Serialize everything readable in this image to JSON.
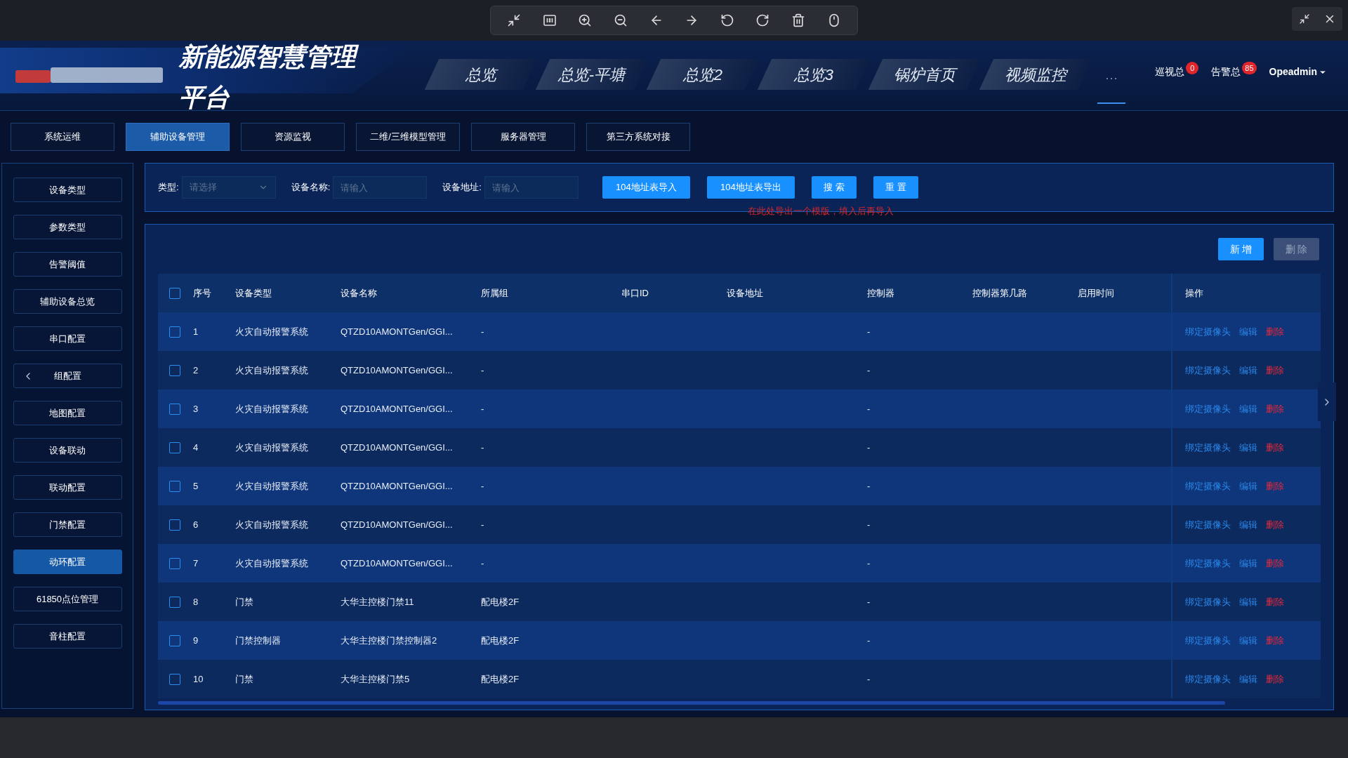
{
  "header": {
    "title_lines": [
      "新能源智慧管理",
      "平台"
    ],
    "nav": [
      {
        "label": "总览",
        "selected": false
      },
      {
        "label": "总览-平塘",
        "selected": false
      },
      {
        "label": "总览2",
        "selected": false
      },
      {
        "label": "总览3",
        "selected": false
      },
      {
        "label": "锅炉首页",
        "selected": false
      },
      {
        "label": "视频监控",
        "selected": false
      },
      {
        "label": "···",
        "selected": true
      }
    ],
    "counters": [
      {
        "label": "巡视总",
        "badge": "0"
      },
      {
        "label": "告警总",
        "badge": "85"
      }
    ],
    "user": "Opeadmin"
  },
  "tabs": [
    {
      "label": "系统运维",
      "selected": false
    },
    {
      "label": "辅助设备管理",
      "selected": true
    },
    {
      "label": "资源监视",
      "selected": false
    },
    {
      "label": "二维/三维模型管理",
      "selected": false
    },
    {
      "label": "服务器管理",
      "selected": false
    },
    {
      "label": "第三方系统对接",
      "selected": false
    }
  ],
  "sidebar": {
    "items": [
      {
        "label": "设备类型",
        "selected": false,
        "handle": false
      },
      {
        "label": "参数类型",
        "selected": false,
        "handle": false
      },
      {
        "label": "告警阈值",
        "selected": false,
        "handle": false
      },
      {
        "label": "辅助设备总览",
        "selected": false,
        "handle": false
      },
      {
        "label": "串口配置",
        "selected": false,
        "handle": false
      },
      {
        "label": "组配置",
        "selected": false,
        "handle": true
      },
      {
        "label": "地图配置",
        "selected": false,
        "handle": false
      },
      {
        "label": "设备联动",
        "selected": false,
        "handle": false
      },
      {
        "label": "联动配置",
        "selected": false,
        "handle": false
      },
      {
        "label": "门禁配置",
        "selected": false,
        "handle": false
      },
      {
        "label": "动环配置",
        "selected": true,
        "handle": false
      },
      {
        "label": "61850点位管理",
        "selected": false,
        "handle": false
      },
      {
        "label": "音柱配置",
        "selected": false,
        "handle": false
      }
    ]
  },
  "filter": {
    "fields": [
      {
        "kind": "select",
        "label": "类型:",
        "placeholder": "请选择"
      },
      {
        "kind": "input",
        "label": "设备名称:",
        "placeholder": "请输入"
      },
      {
        "kind": "input",
        "label": "设备地址:",
        "placeholder": "请输入"
      }
    ],
    "buttons": [
      "104地址表导入",
      "104地址表导出",
      "搜 索",
      "重 置"
    ],
    "hint": "在此处导出一个模版，填入后再导入"
  },
  "table": {
    "buttons": [
      {
        "label": "新 增",
        "disabled": false
      },
      {
        "label": "删 除",
        "disabled": true
      }
    ],
    "all_checked": false,
    "columns": [
      "序号",
      "设备类型",
      "设备名称",
      "所属组",
      "串口ID",
      "设备地址",
      "控制器",
      "控制器第几路",
      "启用时间",
      "操作"
    ],
    "rows": [
      {
        "checked": false,
        "cells": [
          "1",
          "火灾自动报警系统",
          "QTZD10AMONTGen/GGI...",
          "-",
          "",
          "",
          "-",
          "",
          ""
        ],
        "actions": [
          {
            "label": "绑定摄像头",
            "kind": "link"
          },
          {
            "label": "编辑",
            "kind": "link"
          },
          {
            "label": "删除",
            "kind": "danger"
          }
        ]
      },
      {
        "checked": false,
        "cells": [
          "2",
          "火灾自动报警系统",
          "QTZD10AMONTGen/GGI...",
          "-",
          "",
          "",
          "-",
          "",
          ""
        ],
        "actions": [
          {
            "label": "绑定摄像头",
            "kind": "link"
          },
          {
            "label": "编辑",
            "kind": "link"
          },
          {
            "label": "删除",
            "kind": "danger"
          }
        ]
      },
      {
        "checked": false,
        "cells": [
          "3",
          "火灾自动报警系统",
          "QTZD10AMONTGen/GGI...",
          "-",
          "",
          "",
          "-",
          "",
          ""
        ],
        "actions": [
          {
            "label": "绑定摄像头",
            "kind": "link"
          },
          {
            "label": "编辑",
            "kind": "link"
          },
          {
            "label": "删除",
            "kind": "danger"
          }
        ]
      },
      {
        "checked": false,
        "cells": [
          "4",
          "火灾自动报警系统",
          "QTZD10AMONTGen/GGI...",
          "-",
          "",
          "",
          "-",
          "",
          ""
        ],
        "actions": [
          {
            "label": "绑定摄像头",
            "kind": "link"
          },
          {
            "label": "编辑",
            "kind": "link"
          },
          {
            "label": "删除",
            "kind": "danger"
          }
        ]
      },
      {
        "checked": false,
        "cells": [
          "5",
          "火灾自动报警系统",
          "QTZD10AMONTGen/GGI...",
          "-",
          "",
          "",
          "-",
          "",
          ""
        ],
        "actions": [
          {
            "label": "绑定摄像头",
            "kind": "link"
          },
          {
            "label": "编辑",
            "kind": "link"
          },
          {
            "label": "删除",
            "kind": "danger"
          }
        ]
      },
      {
        "checked": false,
        "cells": [
          "6",
          "火灾自动报警系统",
          "QTZD10AMONTGen/GGI...",
          "-",
          "",
          "",
          "-",
          "",
          ""
        ],
        "actions": [
          {
            "label": "绑定摄像头",
            "kind": "link"
          },
          {
            "label": "编辑",
            "kind": "link"
          },
          {
            "label": "删除",
            "kind": "danger"
          }
        ]
      },
      {
        "checked": false,
        "cells": [
          "7",
          "火灾自动报警系统",
          "QTZD10AMONTGen/GGI...",
          "-",
          "",
          "",
          "-",
          "",
          ""
        ],
        "actions": [
          {
            "label": "绑定摄像头",
            "kind": "link"
          },
          {
            "label": "编辑",
            "kind": "link"
          },
          {
            "label": "删除",
            "kind": "danger"
          }
        ]
      },
      {
        "checked": false,
        "cells": [
          "8",
          "门禁",
          "大华主控楼门禁11",
          "配电楼2F",
          "",
          "",
          "-",
          "",
          ""
        ],
        "actions": [
          {
            "label": "绑定摄像头",
            "kind": "link"
          },
          {
            "label": "编辑",
            "kind": "link"
          },
          {
            "label": "删除",
            "kind": "danger"
          }
        ]
      },
      {
        "checked": false,
        "cells": [
          "9",
          "门禁控制器",
          "大华主控楼门禁控制器2",
          "配电楼2F",
          "",
          "",
          "-",
          "",
          ""
        ],
        "actions": [
          {
            "label": "绑定摄像头",
            "kind": "link"
          },
          {
            "label": "编辑",
            "kind": "link"
          },
          {
            "label": "删除",
            "kind": "danger"
          }
        ]
      },
      {
        "checked": false,
        "cells": [
          "10",
          "门禁",
          "大华主控楼门禁5",
          "配电楼2F",
          "",
          "",
          "-",
          "",
          ""
        ],
        "actions": [
          {
            "label": "绑定摄像头",
            "kind": "link"
          },
          {
            "label": "编辑",
            "kind": "link"
          },
          {
            "label": "删除",
            "kind": "danger"
          }
        ]
      }
    ]
  }
}
